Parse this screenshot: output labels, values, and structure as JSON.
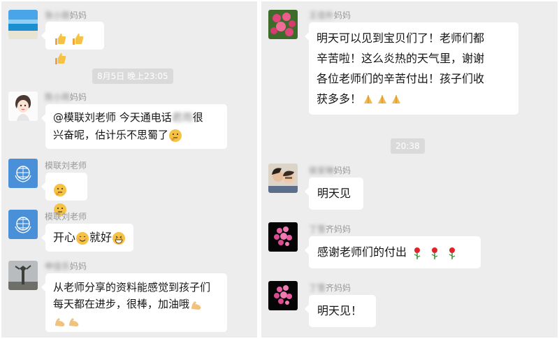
{
  "left_chat": {
    "messages": [
      {
        "sender_suffix": "妈妈",
        "sender_blurred": "张小丽",
        "bubble_lines": [
          ""
        ],
        "emoji": [
          "thumbs-up-icon",
          "thumbs-up-icon",
          "thumbs-up-icon"
        ]
      },
      {
        "timestamp": "8月5日 晚上23:05"
      },
      {
        "sender_suffix": "妈妈",
        "sender_blurred": "陈小雨",
        "bubble_lines": [
          "@模联刘老师  今天通电话",
          "兴奋呢，估计乐不思蜀了"
        ],
        "blurred_in_text": "君雨",
        "after_blur": "很",
        "emoji_end": "thinking-face-icon"
      },
      {
        "sender": "模联刘老师",
        "emoji": [
          "thinking-face-icon",
          "thinking-face-icon"
        ]
      },
      {
        "sender": "模联刘老师",
        "text_before": "开心",
        "text_after": "就好"
      },
      {
        "sender_suffix": "妈妈",
        "sender_blurred": "申佳乐",
        "bubble_lines": [
          "从老师分享的资料能感觉到孩子们",
          "每天都在进步，很棒，加油哦"
        ]
      }
    ]
  },
  "right_chat": {
    "messages": [
      {
        "sender_suffix": "妈妈",
        "sender_blurred": "王佳朴",
        "bubble_lines": [
          "明天可以见到宝贝们了！老师们都",
          "辛苦啦！这么炎热的天气里，谢谢",
          "各位老师们的辛苦付出！孩子们收",
          "获多多！"
        ]
      },
      {
        "timestamp": "20:38"
      },
      {
        "sender_suffix": "妈妈",
        "sender_blurred": "侯安琳",
        "bubble_lines": [
          "明天见"
        ]
      },
      {
        "sender_suffix": "齐妈妈",
        "sender_blurred": "丁雪",
        "bubble_lines": [
          "感谢老师们的付出"
        ]
      },
      {
        "sender_suffix": "齐妈妈",
        "sender_blurred": "丁雪",
        "bubble_lines": [
          "明天见！"
        ]
      }
    ]
  },
  "colors": {
    "background": "#ededed",
    "bubble": "#ffffff",
    "timestamp_bg": "#dadada"
  }
}
